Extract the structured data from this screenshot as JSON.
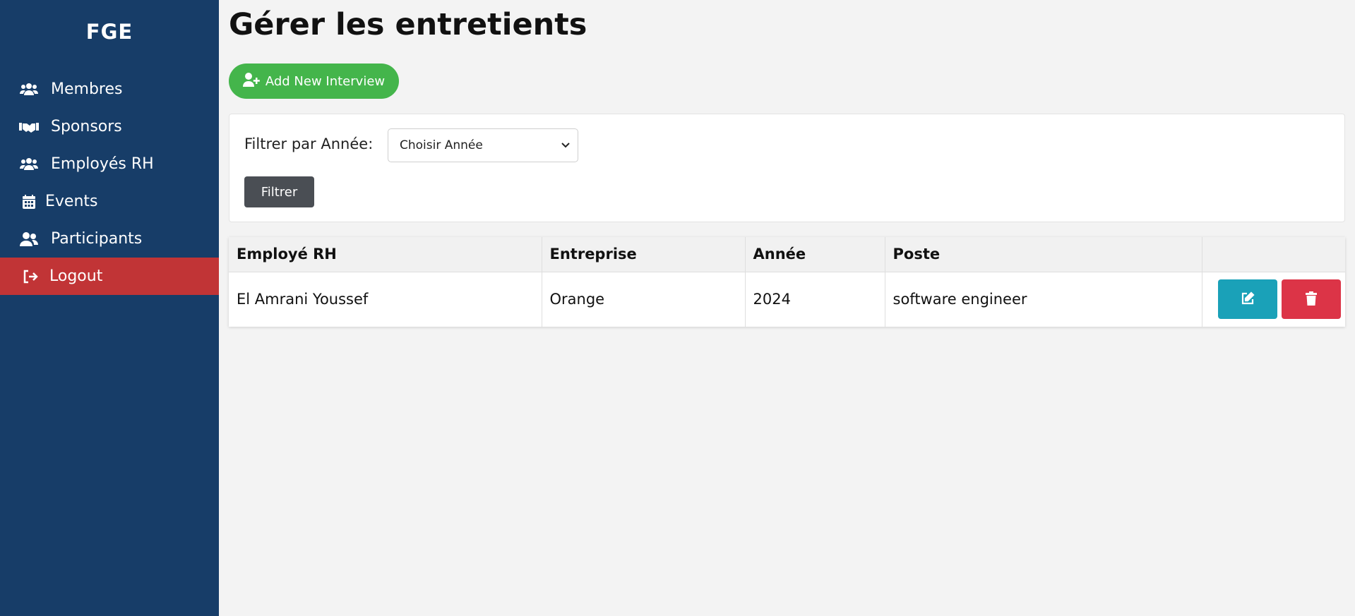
{
  "sidebar": {
    "brand": "FGE",
    "items": [
      {
        "label": "Membres",
        "icon": "users-icon"
      },
      {
        "label": "Sponsors",
        "icon": "handshake-icon"
      },
      {
        "label": "Employés RH",
        "icon": "users-icon"
      },
      {
        "label": "Events",
        "icon": "calendar-icon"
      },
      {
        "label": "Participants",
        "icon": "user-friends-icon"
      },
      {
        "label": "Logout",
        "icon": "sign-out-icon"
      }
    ],
    "logout_color": "#c13436",
    "background": "#173d68"
  },
  "main": {
    "title": "Gérer les entretients",
    "add_button_label": "Add New Interview",
    "add_button_color": "#44b54b"
  },
  "filter": {
    "label": "Filtrer par Année:",
    "select_value": "Choisir Année",
    "button_label": "Filtrer"
  },
  "table": {
    "headers": [
      "Employé RH",
      "Entreprise",
      "Année",
      "Poste",
      ""
    ],
    "rows": [
      {
        "employe": "El Amrani Youssef",
        "entreprise": "Orange",
        "annee": "2024",
        "poste": "software engineer"
      }
    ],
    "edit_color": "#1aa1b8",
    "delete_color": "#dc3447"
  }
}
